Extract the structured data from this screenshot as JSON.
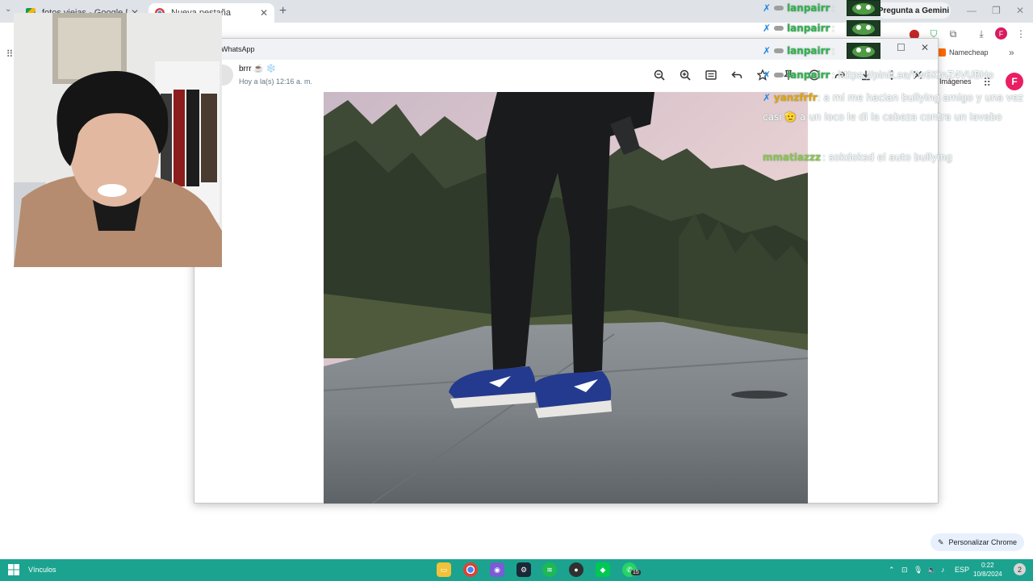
{
  "browser": {
    "tabs": [
      {
        "title": "fotos viejas - Google Drive",
        "active": false
      },
      {
        "title": "Nueva pestaña",
        "active": true
      }
    ],
    "gemini_button": "Pregunta a Gemini",
    "bookmark_namecheap": "Namecheap",
    "profile_initial": "F"
  },
  "google_page": {
    "images_link": "Imágenes",
    "avatar_initial": "F",
    "personalize_button": "Personalizar Chrome"
  },
  "whatsapp": {
    "window_title": "WhatsApp",
    "contact_name": "brrr ☕ ❄️",
    "timestamp": "Hoy a la(s) 12:16 a. m.",
    "toolbar_icons": [
      "zoom-out-icon",
      "zoom-in-icon",
      "message-icon",
      "reply-icon",
      "star-icon",
      "pin-icon",
      "emoji-icon",
      "forward-icon",
      "download-icon",
      "more-icon",
      "close-icon"
    ]
  },
  "chat": {
    "messages": [
      {
        "user": "lanpairr",
        "text": ":"
      },
      {
        "user": "lanpairr",
        "text": ":"
      },
      {
        "user": "lanpairr",
        "text": ":"
      },
      {
        "user": "lanpairr",
        "text": ": https://pinit.se/Yw6KmZ4VUBHo"
      },
      {
        "user": "yanzfrfr",
        "text": ": a mi me hacian bullying amigo y una vez casi",
        "text2": "a un loco le di la cabeza contra un lavabo"
      },
      {
        "user": "mmatiazzz",
        "text": ": sokdoksd el auto bullying"
      }
    ],
    "colors": {
      "lanpairr": "#2fb34a",
      "yanzfrfr": "#e6a100",
      "mmatiazzz": "#8bc34a"
    }
  },
  "taskbar": {
    "links_label": "Vínculos",
    "language": "ESP",
    "time": "0:22",
    "date": "10/8/2024",
    "whatsapp_badge": "15",
    "notification_count": "2"
  }
}
